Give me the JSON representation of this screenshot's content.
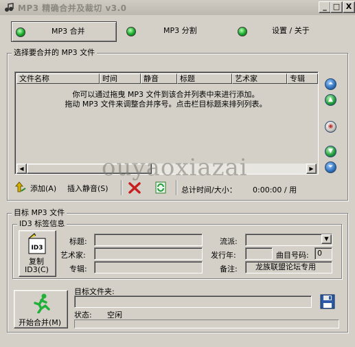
{
  "window": {
    "title": "MP3 精确合并及裁切  v3.0",
    "controls": {
      "minimize": "_",
      "maximize": "□",
      "close": "X"
    }
  },
  "tabs": [
    {
      "label": "MP3 合并",
      "active": true
    },
    {
      "label": "MP3 分割",
      "active": false
    },
    {
      "label": "设置 / 关于",
      "active": false
    }
  ],
  "select_group": {
    "title": "选择要合并的 MP3 文件",
    "columns": [
      "文件名称",
      "时间",
      "静音",
      "标题",
      "艺术家",
      "专辑"
    ],
    "hint_line1": "你可以通过拖曳 MP3 文件到该合并列表中来进行添加。",
    "hint_line2": "拖动 MP3 文件来调整合并序号。点击栏目标题来排列列表。",
    "side_buttons": [
      "move-top",
      "move-up",
      "sort",
      "move-down",
      "move-bottom"
    ]
  },
  "toolbar": {
    "add_label": "添加(A)",
    "insert_silence_label": "插入静音(S)",
    "total_label": "总计时间/大小：",
    "total_value": "0:00:00  /  用"
  },
  "watermark": "ouyaoxiazai",
  "target_group": {
    "title": "目标 MP3 文件",
    "id3": {
      "title": "ID3 标签信息",
      "copy_label_1": "复制",
      "copy_label_2": "ID3(C)",
      "icon_text": "ID3",
      "title_label": "标题:",
      "title_value": "",
      "artist_label": "艺术家:",
      "artist_value": "",
      "album_label": "专辑:",
      "album_value": "",
      "genre_label": "流派:",
      "genre_value": "",
      "year_label": "发行年:",
      "year_value": "",
      "track_label": "曲目号码:",
      "track_value": "0",
      "comment_label": "备注:",
      "comment_value": "龙族联盟论坛专用"
    },
    "start_label": "开始合并(M)",
    "folder_label": "目标文件夹:",
    "folder_value": "",
    "status_label": "状态:",
    "status_value": "空闲",
    "progress": 0
  },
  "colors": {
    "face": "#d4d0c8",
    "led_green": "#16a82a",
    "side_blue": "#2d6fb8",
    "side_green": "#1f9a3a"
  }
}
